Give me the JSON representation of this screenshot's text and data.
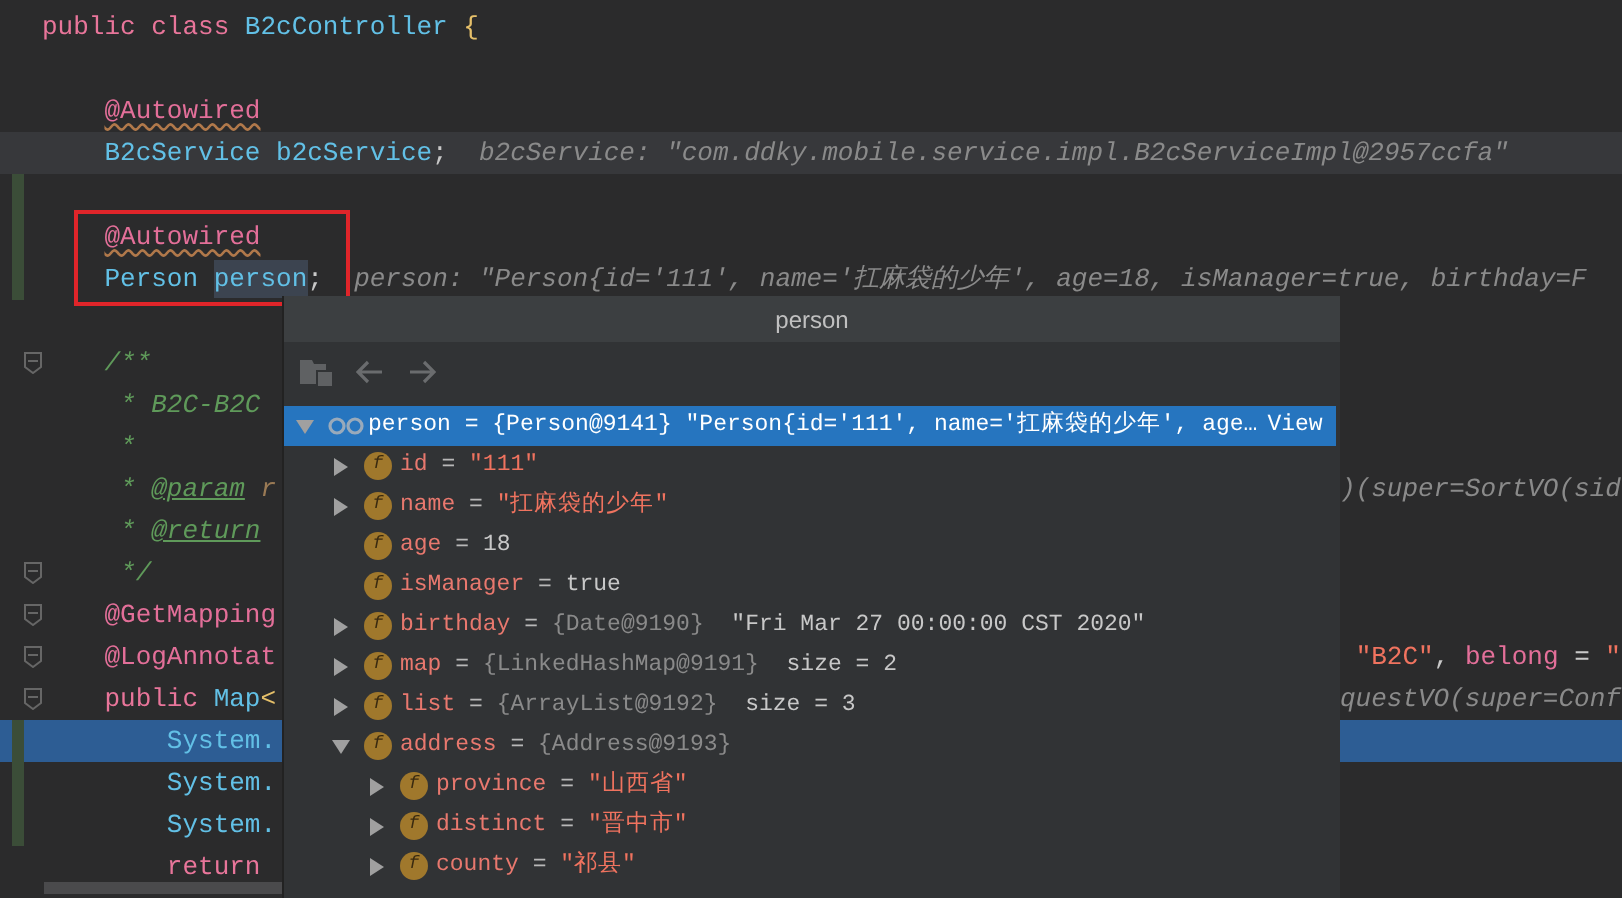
{
  "editor": {
    "blocks": [
      {
        "lines": [
          {
            "segments": [
              {
                "text": "public class ",
                "kind": "keyword"
              },
              {
                "text": "B2cController",
                "kind": "ident"
              },
              {
                "text": " {",
                "kind": "brace"
              }
            ]
          }
        ]
      },
      {
        "lines": [
          {
            "segments": [
              {
                "text": "    @Autowired",
                "kind": "annotation",
                "warn": true
              }
            ]
          },
          {
            "current": true,
            "segments": [
              {
                "text": "    B2cService b2cService",
                "kind": "ident"
              },
              {
                "text": ";",
                "kind": "plain"
              },
              {
                "text": "  b2cService: \"com.ddky.mobile.service.impl.B2cServiceImpl@2957ccfa\"",
                "kind": "hint"
              }
            ]
          }
        ]
      },
      {
        "lines": [
          {
            "changed": true,
            "boxed": true,
            "segments": [
              {
                "text": "    @Autowired",
                "kind": "annotation",
                "warn": true
              }
            ]
          },
          {
            "changed": true,
            "boxed": true,
            "segments": [
              {
                "text": "    Person ",
                "kind": "ident"
              },
              {
                "text": "person",
                "kind": "ident-usage"
              },
              {
                "text": ";",
                "kind": "plain"
              },
              {
                "text": "  person: \"Person{id='111', name='扛麻袋的少年', age=18, isManager=true, birthday=F",
                "kind": "hint"
              }
            ]
          }
        ]
      },
      {
        "lines": [
          {
            "fold": true,
            "segments": [
              {
                "text": "    /**",
                "kind": "comment"
              }
            ]
          },
          {
            "segments": [
              {
                "text": "     * B2C-B2C",
                "kind": "comment"
              }
            ]
          },
          {
            "segments": [
              {
                "text": "     *",
                "kind": "comment"
              }
            ]
          },
          {
            "segments": [
              {
                "text": "     * ",
                "kind": "comment"
              },
              {
                "text": "@param",
                "kind": "doctag"
              },
              {
                "text": " r",
                "kind": "comment-ref"
              }
            ],
            "right": [
              {
                "text": ")(super=SortVO(sid",
                "kind": "hint"
              }
            ]
          },
          {
            "segments": [
              {
                "text": "     * ",
                "kind": "comment"
              },
              {
                "text": "@return",
                "kind": "doctag"
              }
            ]
          },
          {
            "fold": true,
            "segments": [
              {
                "text": "     */",
                "kind": "comment"
              }
            ]
          },
          {
            "fold": true,
            "segments": [
              {
                "text": "    @GetMapping",
                "kind": "annotation"
              }
            ]
          },
          {
            "fold": true,
            "segments": [
              {
                "text": "    @LogAnnotat",
                "kind": "annotation"
              }
            ],
            "right": [
              {
                "text": " \"B2C\"",
                "kind": "string"
              },
              {
                "text": ", ",
                "kind": "plain"
              },
              {
                "text": "belong",
                "kind": "annotation"
              },
              {
                "text": " = ",
                "kind": "plain"
              },
              {
                "text": "\"",
                "kind": "string"
              }
            ]
          },
          {
            "fold": true,
            "segments": [
              {
                "text": "    public ",
                "kind": "keyword"
              },
              {
                "text": "Map",
                "kind": "ident"
              },
              {
                "text": "<",
                "kind": "brace"
              }
            ],
            "right": [
              {
                "text": "questVO(super=Conf",
                "kind": "hint"
              }
            ]
          },
          {
            "changed": true,
            "execution": true,
            "segments": [
              {
                "text": "        System.",
                "kind": "ident"
              }
            ]
          },
          {
            "changed": true,
            "segments": [
              {
                "text": "        System.",
                "kind": "ident"
              }
            ]
          },
          {
            "changed": true,
            "segments": [
              {
                "text": "        System.",
                "kind": "ident"
              }
            ]
          },
          {
            "segments": [
              {
                "text": "        return",
                "kind": "keyword"
              }
            ]
          }
        ]
      }
    ]
  },
  "popup": {
    "title": "person",
    "tree": [
      {
        "kind": "object",
        "selected": true,
        "expanded": true,
        "expandable": true,
        "name": "person",
        "operator": "=",
        "ref": "{Person@9141}",
        "value": "\"Person{id='111', name='扛麻袋的少年', age…",
        "link": "View",
        "children": [
          {
            "kind": "field",
            "badge": "f",
            "selected": false,
            "expandable": true,
            "expanded": false,
            "name": "id",
            "operator": "=",
            "value": "\"111\"",
            "is_string": true
          },
          {
            "kind": "field",
            "badge": "f",
            "selected": false,
            "expandable": true,
            "expanded": false,
            "name": "name",
            "operator": "=",
            "value": "\"扛麻袋的少年\"",
            "is_string": true
          },
          {
            "kind": "field",
            "badge": "f",
            "selected": false,
            "expandable": false,
            "name": "age",
            "operator": "=",
            "value": "18",
            "is_string": false
          },
          {
            "kind": "field",
            "badge": "f",
            "selected": false,
            "expandable": false,
            "name": "isManager",
            "operator": "=",
            "value": "true",
            "is_string": false
          },
          {
            "kind": "field",
            "badge": "f",
            "selected": false,
            "expandable": true,
            "expanded": false,
            "name": "birthday",
            "operator": "=",
            "ref": "{Date@9190}",
            "value": "\"Fri Mar 27 00:00:00 CST 2020\"",
            "is_string": false
          },
          {
            "kind": "field",
            "badge": "f",
            "selected": false,
            "expandable": true,
            "expanded": false,
            "name": "map",
            "operator": "=",
            "ref": "{LinkedHashMap@9191}",
            "value": "size = 2",
            "is_string": false
          },
          {
            "kind": "field",
            "badge": "f",
            "selected": false,
            "expandable": true,
            "expanded": false,
            "name": "list",
            "operator": "=",
            "ref": "{ArrayList@9192}",
            "value": "size = 3",
            "is_string": false
          },
          {
            "kind": "field",
            "badge": "f",
            "selected": false,
            "expandable": true,
            "expanded": true,
            "name": "address",
            "operator": "=",
            "ref": "{Address@9193}",
            "children": [
              {
                "kind": "field",
                "badge": "f",
                "selected": false,
                "expandable": true,
                "expanded": false,
                "name": "province",
                "operator": "=",
                "value": "\"山西省\"",
                "is_string": true
              },
              {
                "kind": "field",
                "badge": "f",
                "selected": false,
                "expandable": true,
                "expanded": false,
                "name": "distinct",
                "operator": "=",
                "value": "\"晋中市\"",
                "is_string": true
              },
              {
                "kind": "field",
                "badge": "f",
                "selected": false,
                "expandable": true,
                "expanded": false,
                "name": "county",
                "operator": "=",
                "value": "\"祁县\"",
                "is_string": true
              }
            ]
          }
        ]
      }
    ]
  }
}
